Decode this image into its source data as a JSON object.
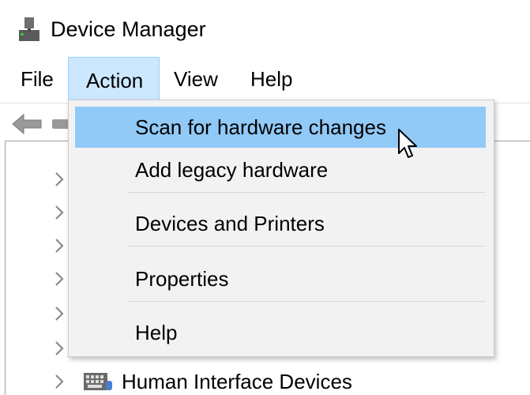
{
  "window": {
    "title": "Device Manager"
  },
  "menubar": {
    "file": "File",
    "action": "Action",
    "view": "View",
    "help": "Help"
  },
  "action_menu": {
    "items": [
      {
        "label": "Scan for hardware changes",
        "highlighted": true
      },
      {
        "label": "Add legacy hardware",
        "highlighted": false
      },
      {
        "label": "Devices and Printers",
        "highlighted": false
      },
      {
        "label": "Properties",
        "highlighted": false
      },
      {
        "label": "Help",
        "highlighted": false
      }
    ]
  },
  "tree": {
    "visible_item": "Human Interface Devices"
  },
  "icons": [
    "device-manager-app-icon",
    "back-arrow-icon",
    "forward-icon",
    "chevron-right-icon",
    "hid-icon",
    "mouse-cursor-icon"
  ],
  "colors": {
    "menu_selected": "#cce8ff",
    "item_highlight": "#91c9f7",
    "dropdown_bg": "#f2f2f2"
  }
}
